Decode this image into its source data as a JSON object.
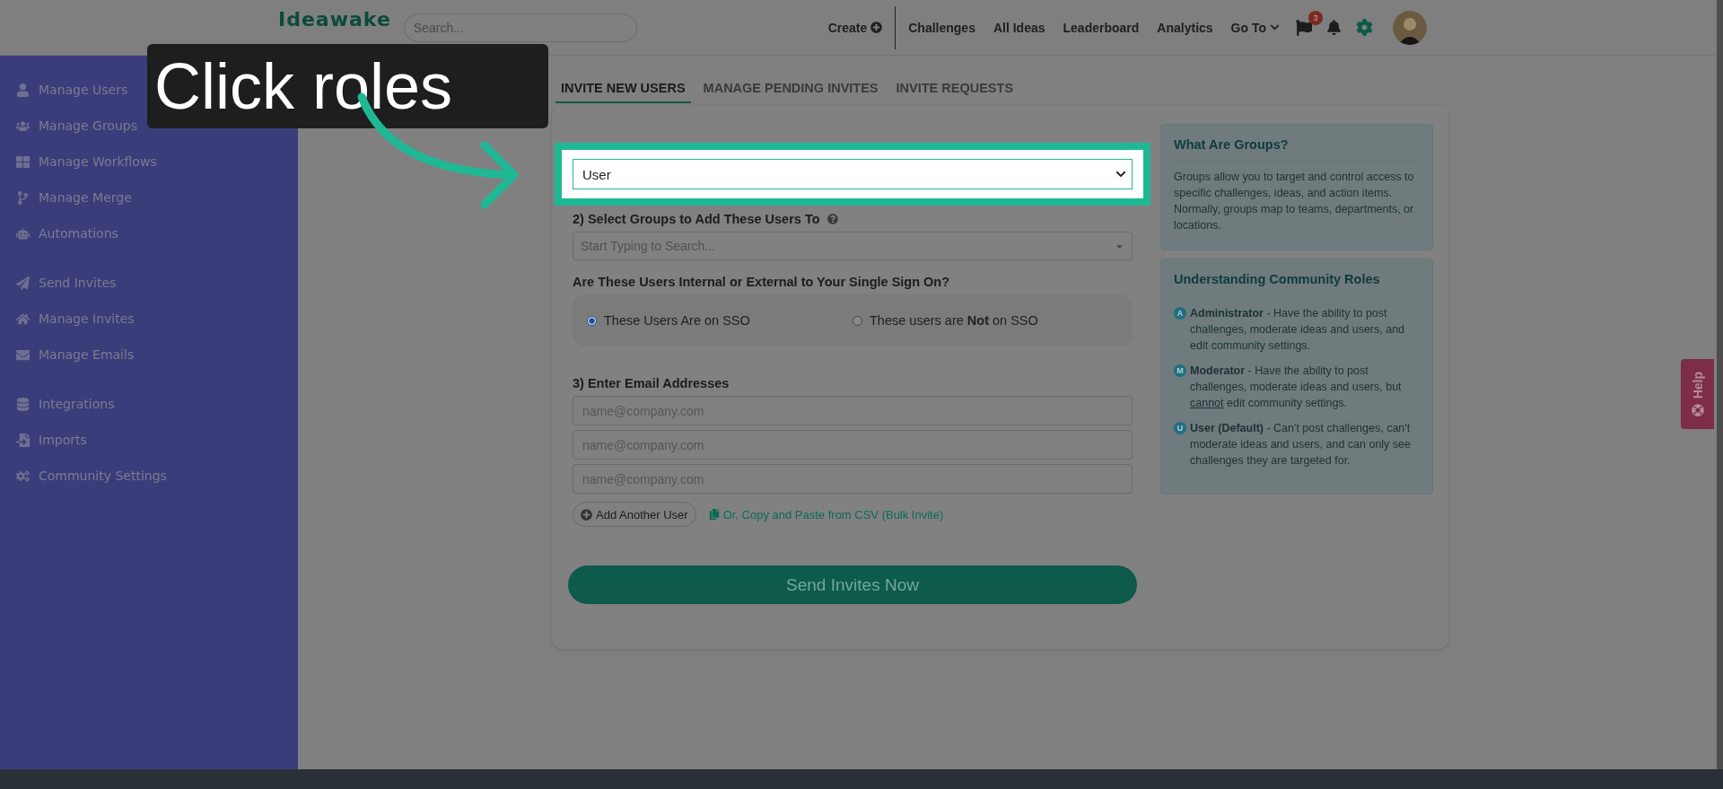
{
  "overlay_caption": "Click roles",
  "header": {
    "logo": "Ideawake",
    "search": {
      "placeholder": "Search..."
    },
    "create": "Create",
    "nav": [
      {
        "kind": "link",
        "label": "Challenges"
      },
      {
        "kind": "link",
        "label": "All Ideas"
      },
      {
        "kind": "link",
        "label": "Leaderboard"
      },
      {
        "kind": "link",
        "label": "Analytics"
      },
      {
        "kind": "dropdown",
        "label": "Go To"
      }
    ],
    "flag_badge": "3"
  },
  "sidebar": {
    "sections": [
      {
        "items": [
          "Manage Users",
          "Manage Groups",
          "Manage Workflows",
          "Manage Merge",
          "Automations"
        ]
      },
      {
        "items": [
          "Send Invites",
          "Manage Invites",
          "Manage Emails"
        ]
      },
      {
        "items": [
          "Integrations",
          "Imports",
          "Community Settings"
        ]
      }
    ]
  },
  "tabs": [
    {
      "label": "INVITE NEW USERS",
      "selected": true
    },
    {
      "label": "MANAGE PENDING INVITES",
      "selected": false
    },
    {
      "label": "INVITE REQUESTS",
      "selected": false
    }
  ],
  "form": {
    "role_select": {
      "value": "User"
    },
    "groups": {
      "label": "2) Select Groups to Add These Users To",
      "placeholder": "Start Typing to Search..."
    },
    "sso": {
      "question": "Are These Users Internal or External to Your Single Sign On?",
      "options": [
        {
          "label": "These Users Are on SSO",
          "selected": true
        },
        {
          "label": "These users are **Not** on SSO",
          "selected": false
        }
      ]
    },
    "emails": {
      "label": "3) Enter Email Addresses",
      "placeholders": [
        "name@company.com",
        "name@company.com",
        "name@company.com"
      ]
    },
    "add_user": "Add Another User",
    "bulk_link": "Or, Copy and Paste from CSV (Bulk Invite)",
    "submit": "Send Invites Now"
  },
  "info": {
    "groups": {
      "title": "What Are Groups?",
      "text": "Groups allow you to target and control access to specific challenges, ideas, and action items. Normally, groups map to teams, departments, or locations."
    },
    "roles": {
      "title": "Understanding Community Roles",
      "items": [
        {
          "badge": "A",
          "parts": [
            {
              "text": "**Administrator** - Have the ability to post challenges, moderate ideas and users, and edit community settings.",
              "underline": false
            }
          ]
        },
        {
          "badge": "M",
          "parts": [
            {
              "text": "**Moderator** - Have the ability to post challenges, moderate ideas and users, but ",
              "underline": false
            },
            {
              "text": "cannot",
              "underline": true
            },
            {
              "text": " edit community settings.",
              "underline": false
            }
          ]
        },
        {
          "badge": "U",
          "parts": [
            {
              "text": "**User (Default)** - Can't post challenges, can't moderate ideas and users, and can only see challenges they are targeted for.",
              "underline": false
            }
          ]
        }
      ]
    }
  },
  "help": "Help"
}
